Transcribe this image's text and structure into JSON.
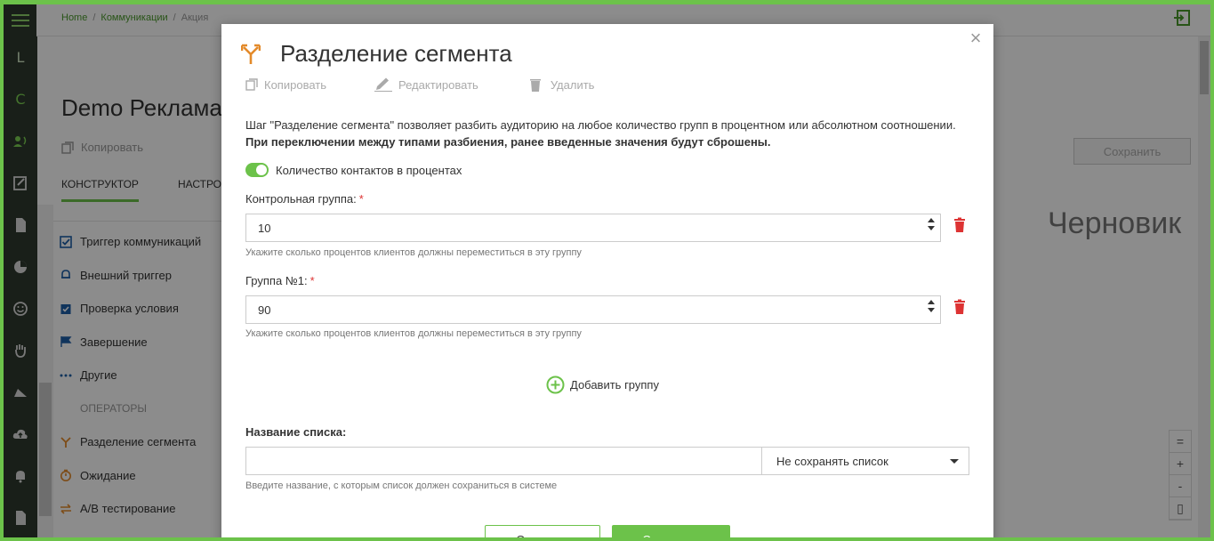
{
  "topbar": {
    "breadcrumb": [
      "Home",
      "Коммуникации",
      "Акция"
    ]
  },
  "sidebar": {
    "items": [
      {
        "label": "L"
      },
      {
        "label": "C"
      }
    ]
  },
  "background": {
    "title": "Demo Реклама",
    "copy_label": "Копировать",
    "tabs": [
      "КОНСТРУКТОР",
      "НАСТРО"
    ],
    "palette": {
      "items": [
        {
          "label": "Триггер коммуникаций",
          "icon": "checkbox-icon"
        },
        {
          "label": "Внешний триггер",
          "icon": "bell-icon"
        },
        {
          "label": "Проверка условия",
          "icon": "clipboard-check-icon"
        },
        {
          "label": "Завершение",
          "icon": "flag-icon"
        },
        {
          "label": "Другие",
          "icon": "dots-icon"
        }
      ],
      "operators_header": "ОПЕРАТОРЫ",
      "operators": [
        {
          "label": "Разделение сегмента",
          "icon": "split-icon"
        },
        {
          "label": "Ожидание",
          "icon": "timer-icon"
        },
        {
          "label": "А/В тестирование",
          "icon": "swap-icon"
        }
      ]
    },
    "save_label": "Сохранить",
    "status": "Черновик",
    "zoom": [
      "=",
      "+",
      "-",
      "▯"
    ]
  },
  "modal": {
    "title": "Разделение сегмента",
    "toolbar": {
      "copy": "Копировать",
      "edit": "Редактировать",
      "delete": "Удалить"
    },
    "description_plain": "Шаг \"Разделение сегмента\" позволяет разбить аудиторию на любое количество групп в процентном или абсолютном соотношении. ",
    "description_bold": "При переключении между типами разбиения, ранее введенные значения будут сброшены.",
    "toggle_label": "Количество контактов в процентах",
    "groups": [
      {
        "label": "Контрольная группа:",
        "value": "10",
        "hint": "Укажите сколько процентов клиентов должны переместиться в эту группу"
      },
      {
        "label": "Группа №1:",
        "value": "90",
        "hint": "Укажите сколько процентов клиентов должны переместиться в эту группу"
      }
    ],
    "add_group": "Добавить группу",
    "list_label": "Название списка:",
    "list_select": "Не сохранять список",
    "list_hint": "Введите название, с которым список должен сохраниться в системе",
    "cancel": "Отменить",
    "save": "Сохранить"
  },
  "colors": {
    "accent": "#6cc24a",
    "sidebar": "#2f3a2e",
    "danger": "#d33",
    "split_icon": "#e38a2a"
  }
}
